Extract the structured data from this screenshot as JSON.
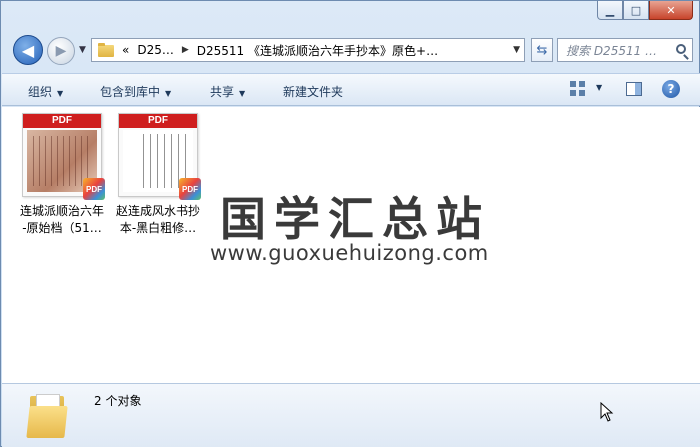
{
  "window": {
    "controls": {
      "minimize": "▁",
      "maximize": "□",
      "close": "✕"
    }
  },
  "nav": {
    "back_icon": "◀",
    "forward_icon": "▶",
    "address_crumbs": [
      "«",
      "D25…",
      "D25511 《连城派顺治六年手抄本》原色+…"
    ],
    "search_placeholder": "搜索 D25511 …"
  },
  "toolbar": {
    "organize": "组织",
    "include_in_library": "包含到库中",
    "share": "共享",
    "new_folder": "新建文件夹"
  },
  "files": [
    {
      "name_line1": "连城派顺治六年",
      "name_line2": "-原始档（51…",
      "thumb_label": "PDF",
      "badge": "PDF"
    },
    {
      "name_line1": "赵连成风水书抄",
      "name_line2": "本-黑白粗修…",
      "thumb_label": "PDF",
      "badge": "PDF"
    }
  ],
  "watermark": {
    "title": "国学汇总站",
    "url": "www.guoxuehuizong.com"
  },
  "details": {
    "count_text": "2 个对象"
  },
  "colors": {
    "frame": "#c9dcf0",
    "pdf_red": "#cf1e1e",
    "text_blue": "#1e395b"
  }
}
